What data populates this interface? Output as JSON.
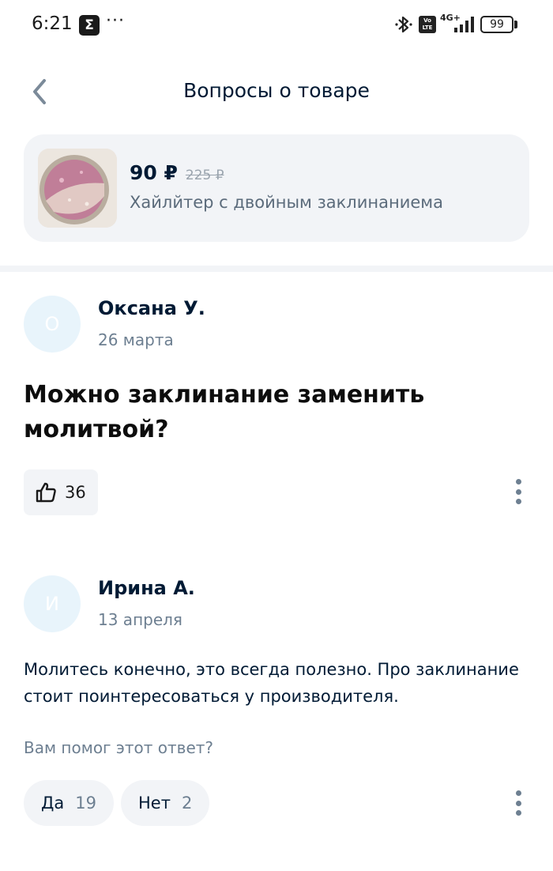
{
  "status_bar": {
    "time": "6:21",
    "sigma": "Σ",
    "dots": "···",
    "volte": "Vo LTE",
    "network": "4G+",
    "battery": "99"
  },
  "header": {
    "title": "Вопросы о товаре"
  },
  "product": {
    "price": "90 ₽",
    "old_price": "225 ₽",
    "name": "Хайлйтер с двойным заклинаниема"
  },
  "question": {
    "avatar_letter": "О",
    "author": "Оксана У.",
    "date": "26 марта",
    "text": "Можно заклинание заменить молитвой?",
    "likes": "36"
  },
  "answer": {
    "avatar_letter": "И",
    "author": "Ирина А.",
    "date": "13 апреля",
    "text": "Молитесь конечно, это всегда полезно. Про заклинание стоит поинтересоваться у производителя.",
    "helpful_question": "Вам помог этот ответ?",
    "yes_label": "Да",
    "yes_count": "19",
    "no_label": "Нет",
    "no_count": "2"
  },
  "colors": {
    "text_primary": "#001a34",
    "text_secondary": "#6d7f91",
    "surface": "#f2f4f7",
    "avatar_bg": "#e8f4fb"
  }
}
